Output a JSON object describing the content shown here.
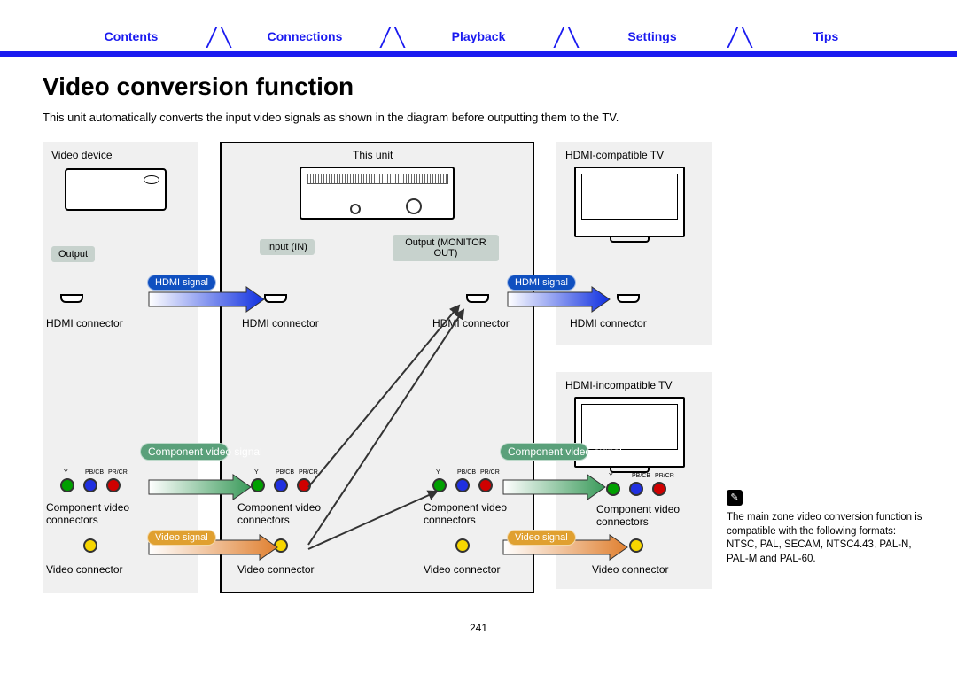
{
  "nav": {
    "contents": "Contents",
    "connections": "Connections",
    "playback": "Playback",
    "settings": "Settings",
    "tips": "Tips"
  },
  "title": "Video conversion function",
  "intro": "This unit automatically converts the input video signals as shown in the diagram before outputting them to the TV.",
  "labels": {
    "video_device": "Video device",
    "this_unit": "This unit",
    "hdmi_tv": "HDMI-compatible TV",
    "incompatible_tv": "HDMI-incompatible TV",
    "output": "Output",
    "input_in": "Input (IN)",
    "output_monitor": "Output (MONITOR OUT)",
    "hdmi_connector": "HDMI connector",
    "component_connectors": "Component video connectors",
    "video_connector": "Video connector"
  },
  "signals": {
    "hdmi": "HDMI signal",
    "component": "Component video signal",
    "video": "Video signal"
  },
  "note": "The main zone video conversion function is compatible with the following formats: NTSC, PAL, SECAM, NTSC4.43, PAL-N, PAL-M and PAL-60.",
  "page_number": "241"
}
